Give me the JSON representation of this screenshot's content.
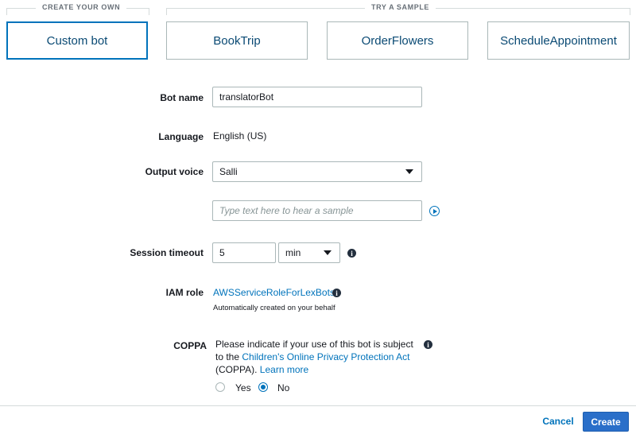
{
  "groups": {
    "create_own": "CREATE YOUR OWN",
    "try_sample": "TRY A SAMPLE"
  },
  "cards": [
    {
      "label": "Custom bot",
      "selected": true
    },
    {
      "label": "BookTrip",
      "selected": false
    },
    {
      "label": "OrderFlowers",
      "selected": false
    },
    {
      "label": "ScheduleAppointment",
      "selected": false
    }
  ],
  "form": {
    "bot_name": {
      "label": "Bot name",
      "value": "translatorBot"
    },
    "language": {
      "label": "Language",
      "value": "English (US)"
    },
    "output_voice": {
      "label": "Output voice",
      "value": "Salli"
    },
    "sample": {
      "placeholder": "Type text here to hear a sample"
    },
    "session_timeout": {
      "label": "Session timeout",
      "value": "5",
      "unit": "min"
    },
    "iam_role": {
      "label": "IAM role",
      "value": "AWSServiceRoleForLexBots",
      "note": "Automatically created on your behalf"
    },
    "coppa": {
      "label": "COPPA",
      "text_before": "Please indicate if your use of this bot is subject to the",
      "link": "Children's Online Privacy Protection Act",
      "text_after": "(COPPA).",
      "learn_more": "Learn more",
      "options": [
        {
          "label": "Yes",
          "checked": false
        },
        {
          "label": "No",
          "checked": true
        }
      ]
    }
  },
  "footer": {
    "cancel": "Cancel",
    "create": "Create"
  },
  "icons": {
    "info": "info-icon",
    "play": "play-icon",
    "dropdown": "chevron-down-icon"
  },
  "colors": {
    "accent": "#0073bb",
    "primary_button": "#2a6fc9"
  }
}
